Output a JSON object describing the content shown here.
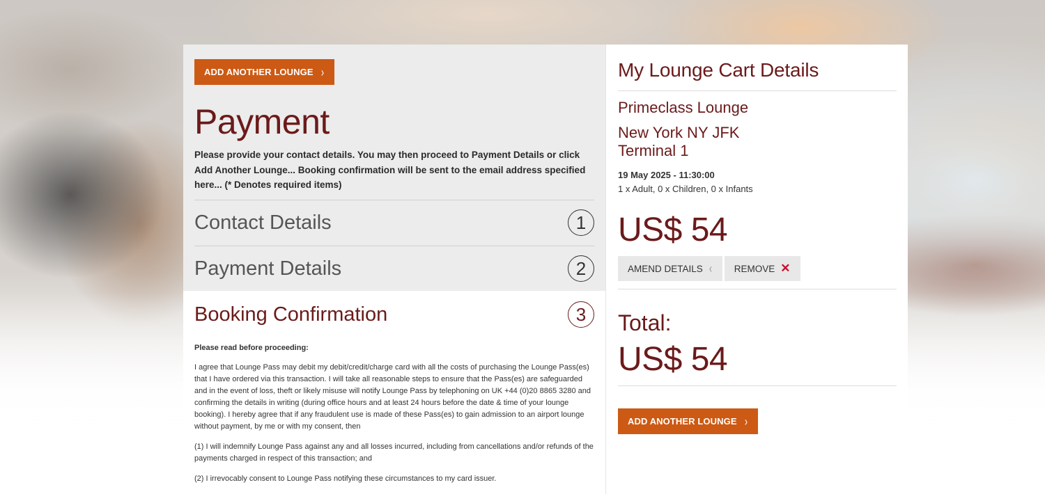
{
  "left": {
    "add_lounge_label": "ADD ANOTHER LOUNGE",
    "title": "Payment",
    "intro": "Please provide your contact details. You may then proceed to Payment Details or click Add Another Lounge... Booking confirmation will be sent to the email address specified here... (* Denotes required items)",
    "steps": [
      {
        "title": "Contact Details",
        "number": "1"
      },
      {
        "title": "Payment Details",
        "number": "2"
      },
      {
        "title": "Booking Confirmation",
        "number": "3"
      }
    ],
    "read_first": "Please read before proceeding:",
    "terms": [
      "I agree that Lounge Pass may debit my debit/credit/charge card with all the costs of purchasing the Lounge Pass(es) that I have ordered via this transaction. I will take all reasonable steps to ensure that the Pass(es) are safeguarded and in the event of loss, theft or likely misuse will notify Lounge Pass by telephoning on UK +44 (0)20 8865 3280 and confirming the details in writing (during office hours and at least 24 hours before the date & time of your lounge booking). I hereby agree that if any fraudulent use is made of these Pass(es) to gain admission to an airport lounge without payment, by me or with my consent, then",
      "(1) I will indemnify Lounge Pass against any and all losses incurred, including from cancellations and/or refunds of the payments charged in respect of this transaction; and",
      "(2) I irrevocably consent to Lounge Pass notifying these circumstances to my card issuer."
    ]
  },
  "cart": {
    "title": "My Lounge Cart Details",
    "lounge_name": "Primeclass Lounge",
    "location_line1": "New York NY JFK",
    "location_line2": "Terminal 1",
    "datetime": "19 May 2025 - 11:30:00",
    "passengers": "1 x Adult, 0 x Children, 0 x Infants",
    "price": "US$ 54",
    "amend_label": "AMEND DETAILS",
    "remove_label": "REMOVE",
    "total_label": "Total:",
    "total_price": "US$ 54",
    "add_lounge_label": "ADD ANOTHER LOUNGE"
  },
  "colors": {
    "accent": "#cc5a14",
    "heading": "#6b1a1a",
    "remove_icon": "#c8102e"
  },
  "icons": {
    "chevron_right": "›",
    "chevron_left": "‹",
    "close": "✕"
  }
}
